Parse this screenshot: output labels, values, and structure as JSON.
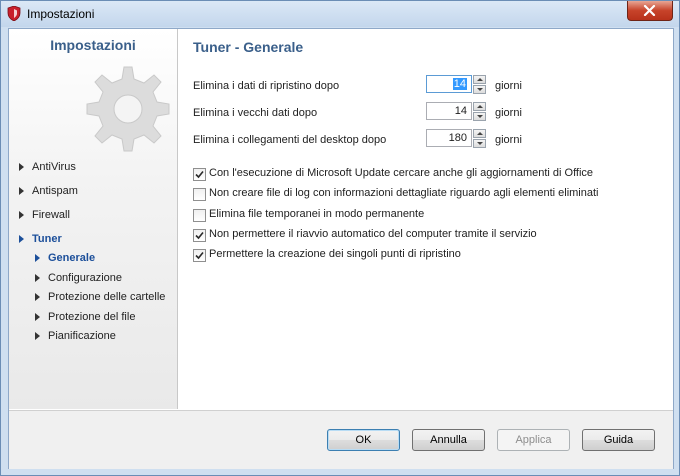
{
  "window": {
    "title": "Impostazioni"
  },
  "sidebar": {
    "title": "Impostazioni",
    "items": [
      {
        "label": "AntiVirus"
      },
      {
        "label": "Antispam"
      },
      {
        "label": "Firewall"
      },
      {
        "label": "Tuner"
      },
      {
        "label": "Generale"
      },
      {
        "label": "Configurazione"
      },
      {
        "label": "Protezione delle cartelle"
      },
      {
        "label": "Protezione del file"
      },
      {
        "label": "Pianificazione"
      }
    ]
  },
  "content": {
    "title": "Tuner - Generale",
    "rows": [
      {
        "label": "Elimina i dati di ripristino dopo",
        "value": "14",
        "unit": "giorni"
      },
      {
        "label": "Elimina i vecchi dati dopo",
        "value": "14",
        "unit": "giorni"
      },
      {
        "label": "Elimina i collegamenti del desktop dopo",
        "value": "180",
        "unit": "giorni"
      }
    ],
    "checkboxes": [
      {
        "label": "Con l'esecuzione di Microsoft Update cercare anche gli aggiornamenti di Office",
        "checked": true
      },
      {
        "label": "Non creare file di log con informazioni dettagliate riguardo agli elementi eliminati",
        "checked": false
      },
      {
        "label": "Elimina file temporanei in modo permanente",
        "checked": false
      },
      {
        "label": "Non permettere il riavvio automatico del computer tramite il servizio",
        "checked": true
      },
      {
        "label": "Permettere la creazione dei singoli punti di ripristino",
        "checked": true
      }
    ]
  },
  "footer": {
    "ok": "OK",
    "cancel": "Annulla",
    "apply": "Applica",
    "help": "Guida"
  }
}
